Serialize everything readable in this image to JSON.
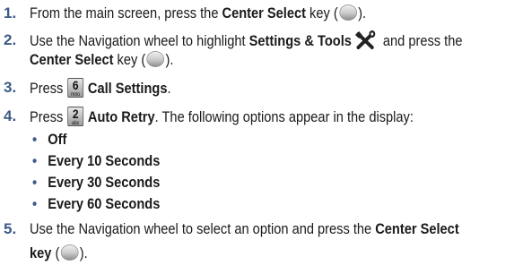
{
  "steps": [
    {
      "num": "1.",
      "parts": [
        "From the main screen, press the ",
        "Center Select",
        " key (",
        ")."
      ]
    },
    {
      "num": "2.",
      "parts": [
        "Use the Navigation wheel to highlight ",
        "Settings & Tools",
        " and press the",
        "Center Select",
        " key (",
        ")."
      ]
    },
    {
      "num": "3.",
      "parts": [
        "Press",
        "Call Settings",
        "."
      ],
      "key": {
        "digit": "6",
        "letters": "mno"
      }
    },
    {
      "num": "4.",
      "parts": [
        "Press",
        "Auto Retry",
        ". The following options appear in the display:"
      ],
      "key": {
        "digit": "2",
        "letters": "abc"
      }
    },
    {
      "num": "5.",
      "parts": [
        "Use the Navigation wheel to select an option and press the ",
        "Center Select",
        "key",
        " (",
        ")."
      ]
    }
  ],
  "options": [
    "Off",
    "Every 10 Seconds",
    "Every 30 Seconds",
    "Every 60 Seconds"
  ],
  "icons": {
    "center_select": "center-select-key-icon",
    "tools": "settings-tools-icon",
    "key6": "keypad-6-key-icon",
    "key2": "keypad-2-key-icon"
  },
  "colors": {
    "step_number": "#3c5a86",
    "text": "#1a1a1a"
  }
}
